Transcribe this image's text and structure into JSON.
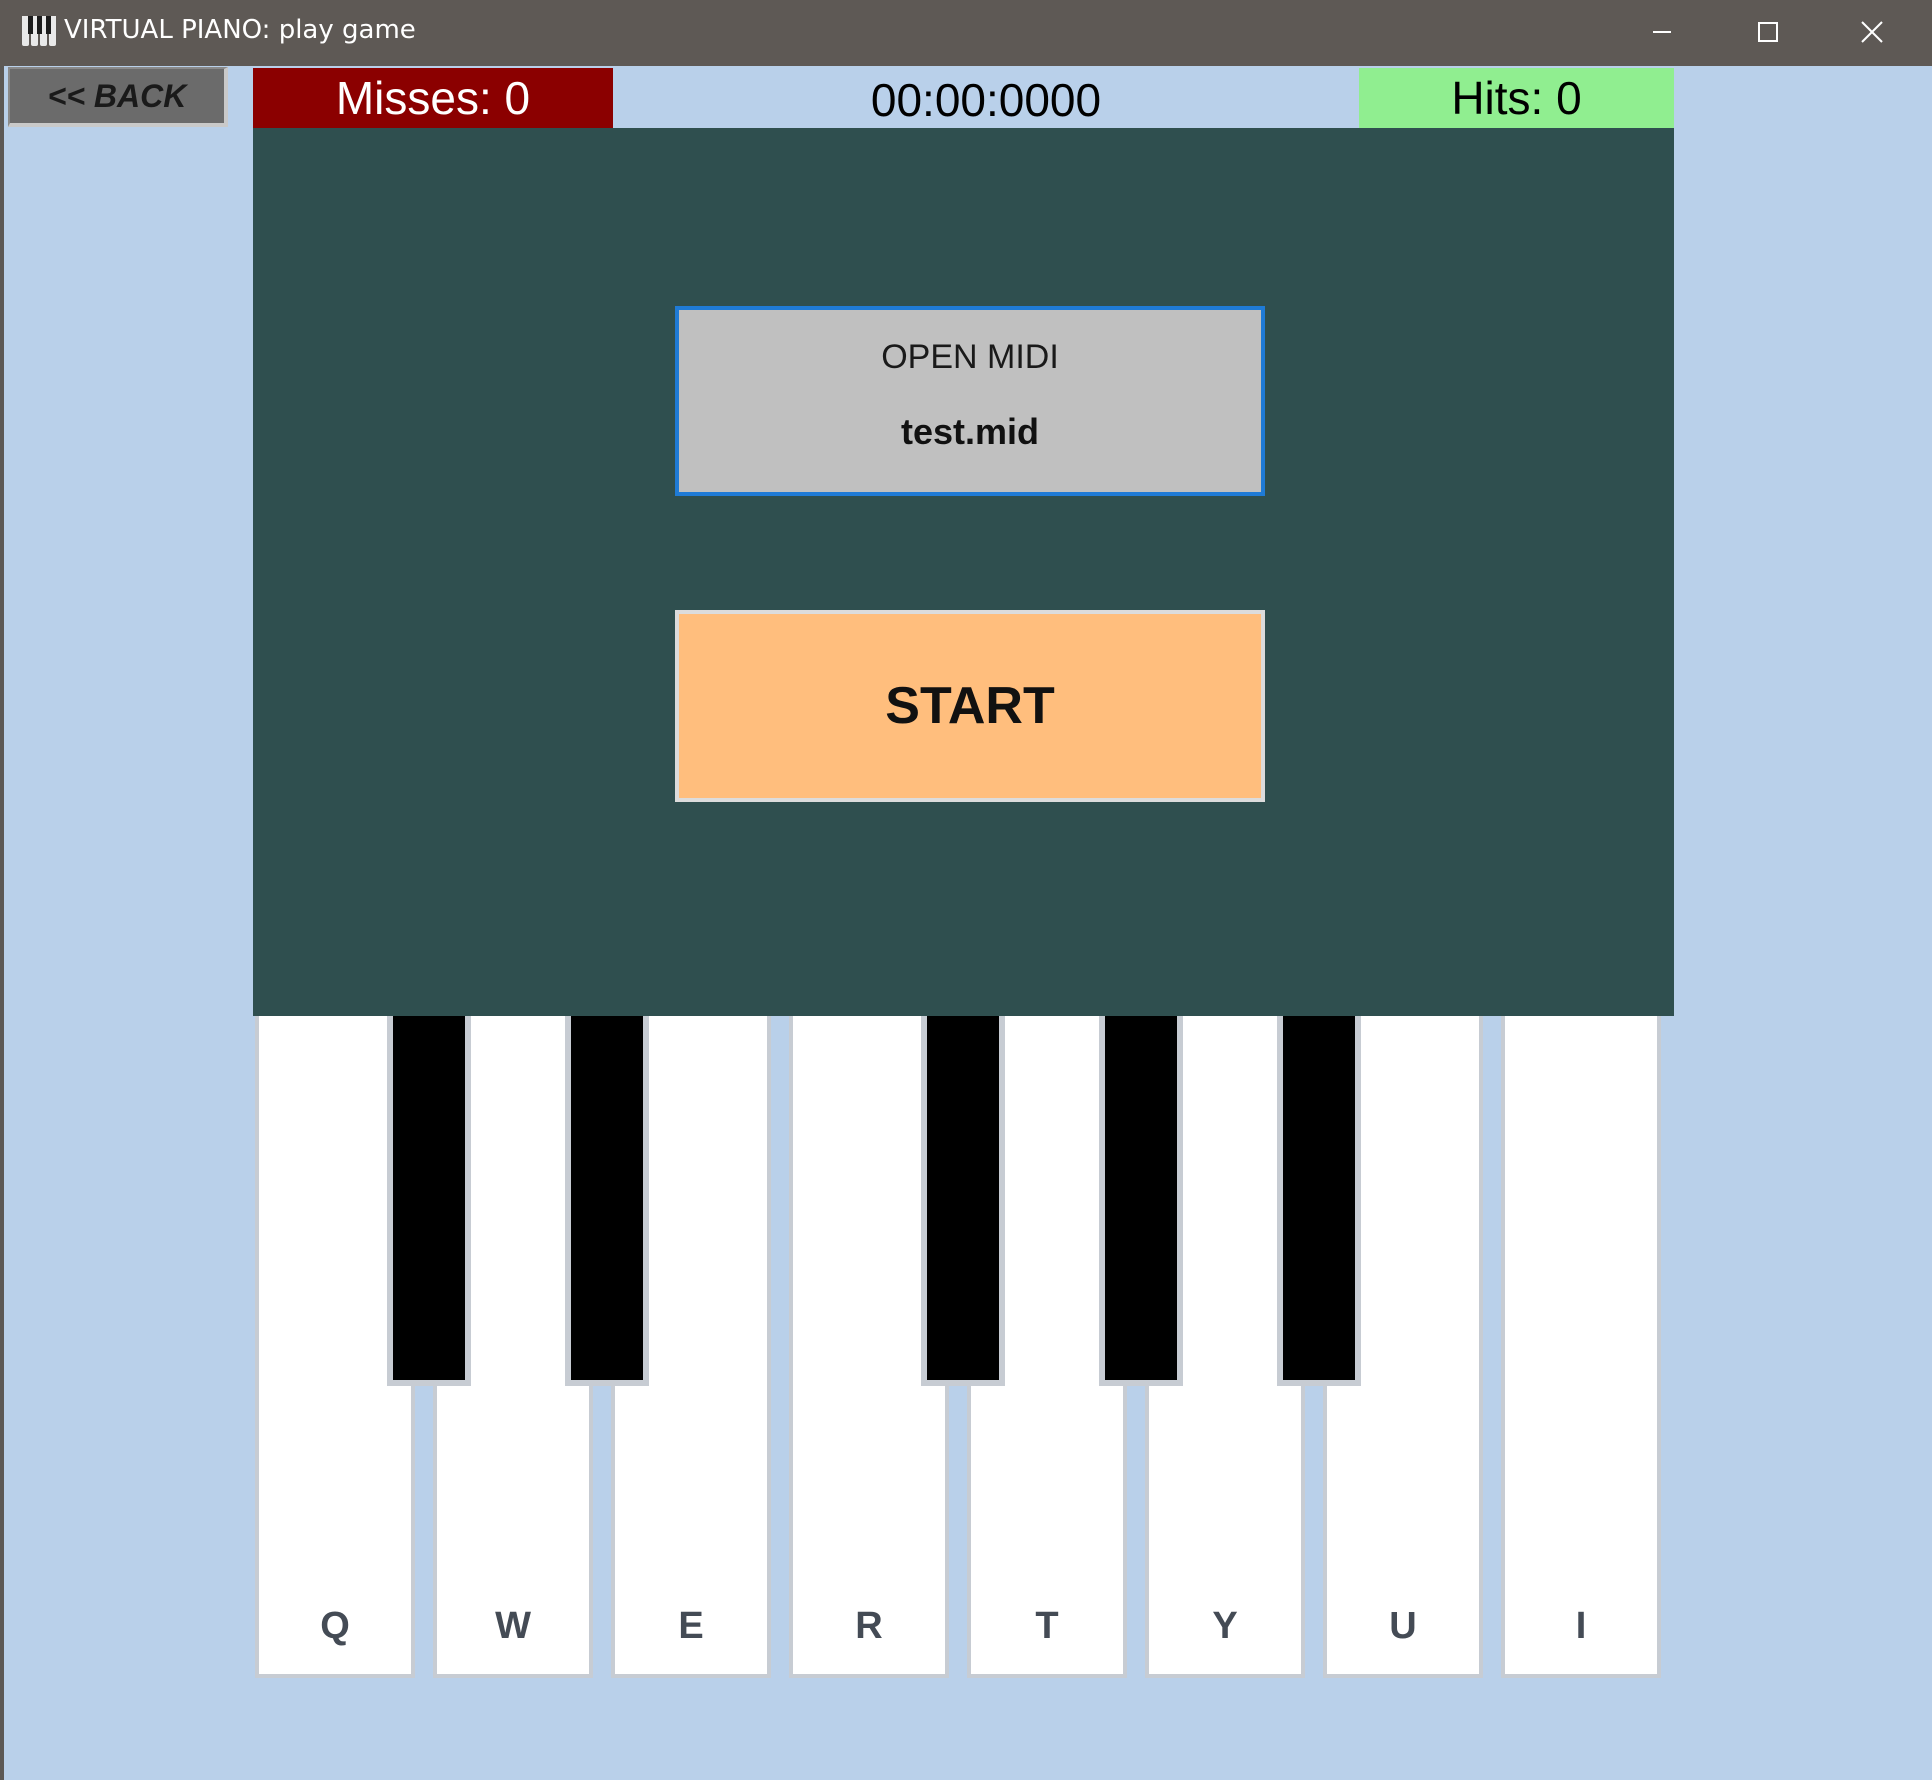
{
  "window": {
    "title": "VIRTUAL PIANO: play game",
    "app_icon": "piano-keys-icon",
    "controls": [
      "minimize-icon",
      "maximize-icon",
      "close-icon"
    ]
  },
  "toolbar": {
    "back_label": "<< BACK",
    "misses_label": "Misses:  0",
    "timer": "00:00:0000",
    "hits_label": "Hits:  0"
  },
  "stage": {
    "open_midi_label": "OPEN MIDI",
    "midi_file": "test.mid",
    "start_label": "START"
  },
  "piano": {
    "white_keys": [
      "Q",
      "W",
      "E",
      "R",
      "T",
      "Y",
      "U",
      "I"
    ]
  },
  "colors": {
    "misses_bg": "#8b0000",
    "hits_bg": "#90ee90",
    "stage_bg": "#2f4f4f",
    "start_bg": "#ffbe7d",
    "window_bg": "#b9d0ea",
    "focus_border": "#1f7bd6"
  }
}
